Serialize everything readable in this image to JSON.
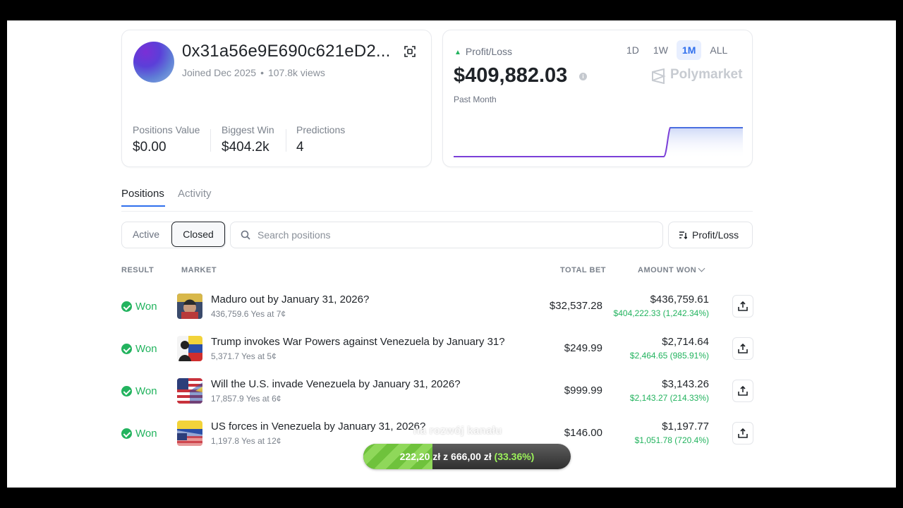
{
  "profile": {
    "wallet": "0x31a56e9E690c621eD2...",
    "joined": "Joined Dec 2025",
    "views": "107.8k views",
    "stats": [
      {
        "label": "Positions Value",
        "value": "$0.00"
      },
      {
        "label": "Biggest Win",
        "value": "$404.2k"
      },
      {
        "label": "Predictions",
        "value": "4"
      }
    ]
  },
  "pnl": {
    "label": "Profit/Loss",
    "periods": [
      "1D",
      "1W",
      "1M",
      "ALL"
    ],
    "active_period": "1M",
    "value": "$409,882.03",
    "subtitle": "Past Month",
    "brand": "Polymarket",
    "colors": {
      "line": "#7b3fd8",
      "area": "#dfe6fb",
      "positive": "#22b35e",
      "accent": "#2f6fed"
    }
  },
  "tabs": [
    "Positions",
    "Activity"
  ],
  "filters": {
    "segments": [
      "Active",
      "Closed"
    ],
    "selected": "Closed",
    "search_placeholder": "Search positions",
    "sort_label": "Profit/Loss"
  },
  "table": {
    "headers": {
      "result": "RESULT",
      "market": "MARKET",
      "total_bet": "TOTAL BET",
      "amount_won": "AMOUNT WON"
    },
    "rows": [
      {
        "result": "Won",
        "title": "Maduro out by January 31, 2026?",
        "sub": "436,759.6 Yes at 7¢",
        "total_bet": "$32,537.28",
        "amount_won": "$436,759.61",
        "gain": "$404,222.33 (1,242.34%)"
      },
      {
        "result": "Won",
        "title": "Trump invokes War Powers against Venezuela by January 31?",
        "sub": "5,371.7 Yes at 5¢",
        "total_bet": "$249.99",
        "amount_won": "$2,714.64",
        "gain": "$2,464.65 (985.91%)"
      },
      {
        "result": "Won",
        "title": "Will the U.S. invade Venezuela by January 31, 2026?",
        "sub": "17,857.9 Yes at 6¢",
        "total_bet": "$999.99",
        "amount_won": "$3,143.26",
        "gain": "$2,143.27 (214.33%)"
      },
      {
        "result": "Won",
        "title": "US forces in Venezuela by January 31, 2026?",
        "sub": "1,197.8 Yes at 12¢",
        "total_bet": "$146.00",
        "amount_won": "$1,197.77",
        "gain": "$1,051.78 (720.4%)"
      }
    ]
  },
  "overlay": {
    "caption": "na rozwój kanału",
    "progress_label": "222,20 zł",
    "progress_of": "z",
    "progress_goal": "666,00 zł",
    "progress_pct": "(33.36%)",
    "progress_fraction": 0.3336
  }
}
